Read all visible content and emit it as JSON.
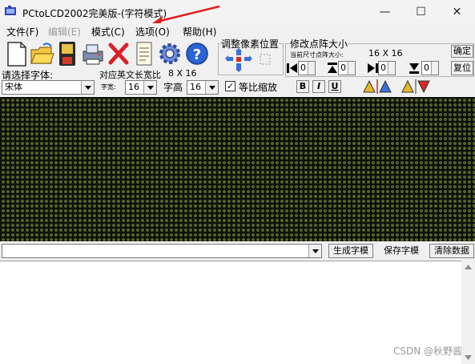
{
  "window": {
    "title": "PCtoLCD2002完美版-(字符模式)",
    "controls": {
      "minimize": "—",
      "maximize": "☐",
      "close": "✕"
    }
  },
  "menu": {
    "items": [
      {
        "label": "文件(F)",
        "enabled": true
      },
      {
        "label": "编辑(E)",
        "enabled": false
      },
      {
        "label": "模式(C)",
        "enabled": true
      },
      {
        "label": "选项(O)",
        "enabled": true
      },
      {
        "label": "帮助(H)",
        "enabled": true
      }
    ]
  },
  "toolbar": {
    "icons": [
      "new-file-icon",
      "open-folder-icon",
      "save-disk-icon",
      "print-icon",
      "delete-x-icon",
      "notepad-icon",
      "settings-gear-icon",
      "help-question-icon"
    ],
    "adjust_pixel_title": "调整像素位置",
    "resize_title": "修改点阵大小",
    "current_size_label": "当前尺寸点阵大小:",
    "current_size_value": "16 X 16",
    "confirm_label": "确定",
    "restore_label": "复位",
    "spin_values": [
      "0",
      "0",
      "0",
      "0"
    ]
  },
  "font": {
    "select_label": "请选择字体:",
    "font_name": "宋体",
    "ratio_label": "对应英文长宽比",
    "ratio_value": "8 X 16",
    "width_label": "字宽:",
    "width_value": "16",
    "height_label": "字高",
    "height_value": "16",
    "scale_label": "等比缩放",
    "scale_checked": "✓",
    "bold": "B",
    "italic": "I",
    "underline": "U"
  },
  "bottom": {
    "generate_label": "生成字模",
    "save_label": "保存字模",
    "clear_label": "清除数据"
  },
  "watermark": "CSDN @秋野酱",
  "colors": {
    "grid_background": "#11130d",
    "pixel_off": "#5b6a2e",
    "window_bg": "#f0f0f0"
  }
}
